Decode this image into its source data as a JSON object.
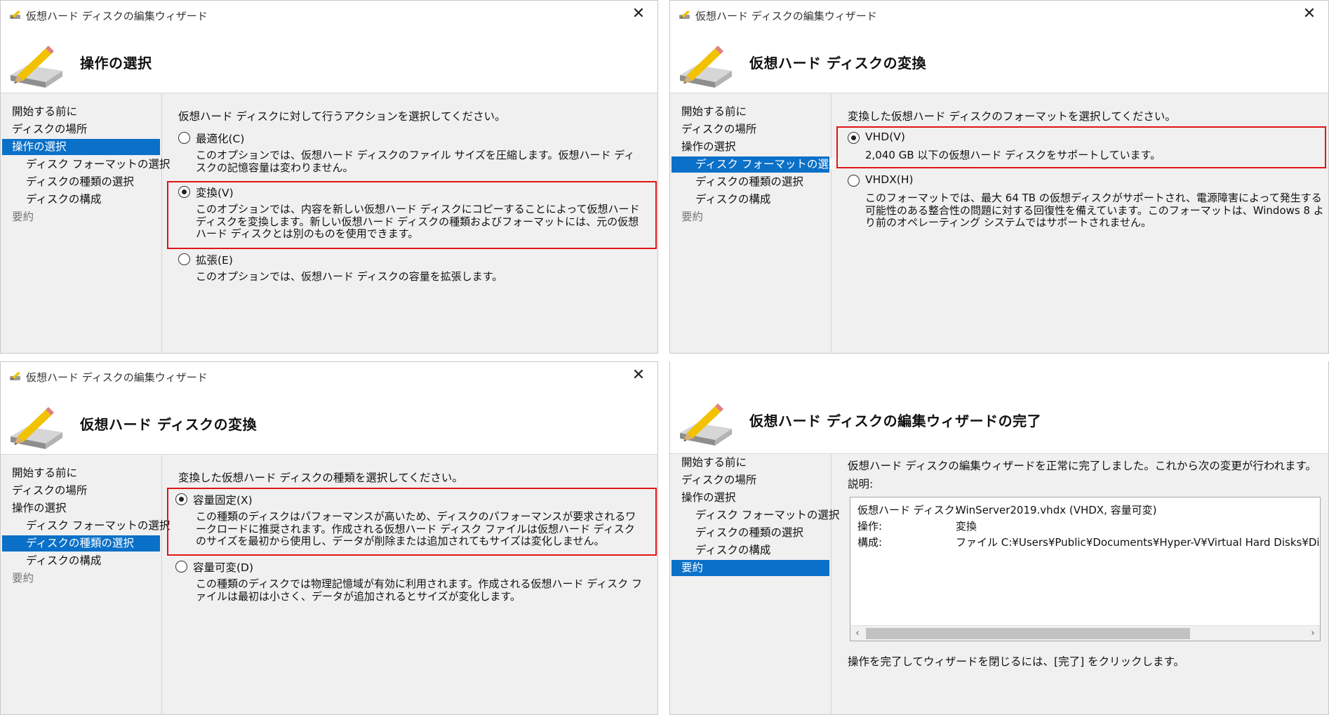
{
  "window_title": "仮想ハード ディスクの編集ウィザード",
  "close_glyph": "✕",
  "nav_items": [
    "開始する前に",
    "ディスクの場所",
    "操作の選択",
    "ディスク フォーマットの選択",
    "ディスクの種類の選択",
    "ディスクの構成",
    "要約"
  ],
  "panel1": {
    "header_title": "操作の選択",
    "prompt": "仮想ハード ディスクに対して行うアクションを選択してください。",
    "options": [
      {
        "label": "最適化(C)",
        "desc": "このオプションでは、仮想ハード ディスクのファイル サイズを圧縮します。仮想ハード ディスクの記憶容量は変わりません。",
        "selected": false
      },
      {
        "label": "変換(V)",
        "desc": "このオプションでは、内容を新しい仮想ハード ディスクにコピーすることによって仮想ハード ディスクを変換します。新しい仮想ハード ディスクの種類およびフォーマットには、元の仮想ハード ディスクとは別のものを使用できます。",
        "selected": true
      },
      {
        "label": "拡張(E)",
        "desc": "このオプションでは、仮想ハード ディスクの容量を拡張します。",
        "selected": false
      }
    ]
  },
  "panel2": {
    "header_title": "仮想ハード ディスクの変換",
    "prompt": "変換した仮想ハード ディスクのフォーマットを選択してください。",
    "options": [
      {
        "label": "VHD(V)",
        "desc": "2,040 GB 以下の仮想ハード ディスクをサポートしています。",
        "selected": true
      },
      {
        "label": "VHDX(H)",
        "desc": "このフォーマットでは、最大 64 TB の仮想ディスクがサポートされ、電源障害によって発生する可能性のある整合性の問題に対する回復性を備えています。このフォーマットは、Windows 8 より前のオペレーティング システムではサポートされません。",
        "selected": false
      }
    ]
  },
  "panel3": {
    "header_title": "仮想ハード ディスクの変換",
    "prompt": "変換した仮想ハード ディスクの種類を選択してください。",
    "options": [
      {
        "label": "容量固定(X)",
        "desc": "この種類のディスクはパフォーマンスが高いため、ディスクのパフォーマンスが要求されるワークロードに推奨されます。作成される仮想ハード ディスク ファイルは仮想ハード ディスクのサイズを最初から使用し、データが削除または追加されてもサイズは変化しません。",
        "selected": true
      },
      {
        "label": "容量可変(D)",
        "desc": "この種類のディスクでは物理記憶域が有効に利用されます。作成される仮想ハード ディスク ファイルは最初は小さく、データが追加されるとサイズが変化します。",
        "selected": false
      }
    ]
  },
  "panel4": {
    "header_title": "仮想ハード ディスクの編集ウィザードの完了",
    "intro": "仮想ハード ディスクの編集ウィザードを正常に完了しました。これから次の変更が行われます。",
    "desc_label": "説明:",
    "summary_rows": [
      {
        "key": "仮想ハード ディスク:",
        "value": "WinServer2019.vhdx (VHDX, 容量可変)"
      },
      {
        "key": "操作:",
        "value": "変換"
      },
      {
        "key": "構成:",
        "value": "ファイル C:¥Users¥Public¥Documents¥Hyper-V¥Virtual Hard Disks¥DirectUploadTe"
      }
    ],
    "scroll_left": "‹",
    "scroll_right": "›",
    "footer": "操作を完了してウィザードを閉じるには、[完了] をクリックします。"
  }
}
